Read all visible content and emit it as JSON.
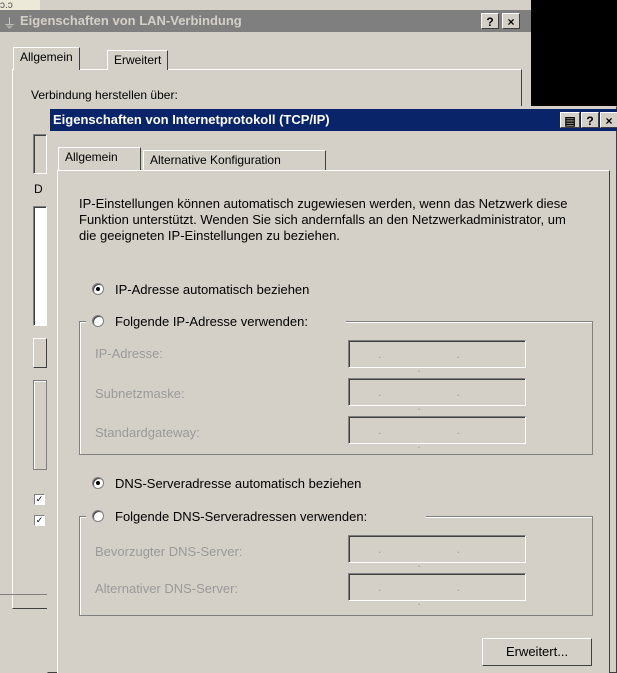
{
  "top_strip": "ɔ.ɔ",
  "bg_window": {
    "title": "Eigenschaften von LAN-Verbindung",
    "help_button": "?",
    "close_button": "×",
    "tabs": [
      "Allgemein",
      "Erweitert"
    ],
    "partial_label": "Verbindung herstellen über:",
    "partial_label2": "D"
  },
  "dialog": {
    "title": "Eigenschaften von Internetprotokoll (TCP/IP)",
    "help_button": "?",
    "close_button": "×",
    "tabs": [
      "Allgemein",
      "Alternative Konfiguration"
    ],
    "description": "IP-Einstellungen können automatisch zugewiesen werden, wenn das Netzwerk diese Funktion unterstützt. Wenden Sie sich andernfalls an den Netzwerkadministrator, um die geeigneten IP-Einstellungen zu beziehen.",
    "ip_auto": "IP-Adresse automatisch beziehen",
    "ip_manual": "Folgende IP-Adresse verwenden:",
    "ip_fields": [
      "IP-Adresse:",
      "Subnetzmaske:",
      "Standardgateway:"
    ],
    "dns_auto": "DNS-Serveradresse automatisch beziehen",
    "dns_manual": "Folgende DNS-Serveradressen verwenden:",
    "dns_fields": [
      "Bevorzugter DNS-Server:",
      "Alternativer DNS-Server:"
    ],
    "ip_placeholder": ". . .",
    "advanced_button": "Erweitert..."
  }
}
